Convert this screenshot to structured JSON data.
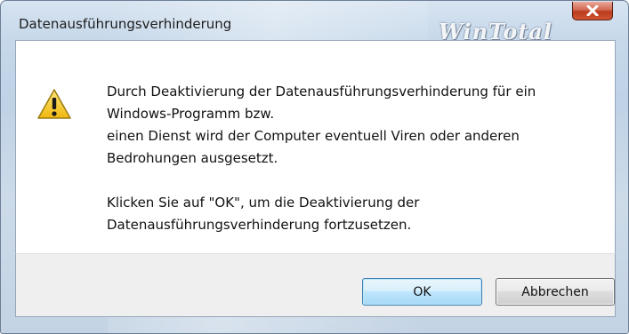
{
  "window": {
    "title": "Datenausführungsverhinderung",
    "watermark": "WinTotal",
    "close_glyph": "X"
  },
  "dialog": {
    "icon": "warning-icon",
    "message_lines": [
      "Durch Deaktivierung der Datenausführungsverhinderung für ein",
      "Windows-Programm bzw.",
      "einen Dienst wird der Computer eventuell Viren oder anderen",
      "Bedrohungen ausgesetzt."
    ],
    "confirm_lines": [
      "Klicken Sie auf \"OK\", um die Deaktivierung der",
      "Datenausführungsverhinderung fortzusetzen."
    ]
  },
  "buttons": {
    "ok_label": "OK",
    "cancel_label": "Abbrechen"
  },
  "colors": {
    "frame": "#c6d8ea",
    "close_button": "#c7462a",
    "warning_fill": "#f3c51c",
    "ok_border": "#3c7fb1"
  }
}
